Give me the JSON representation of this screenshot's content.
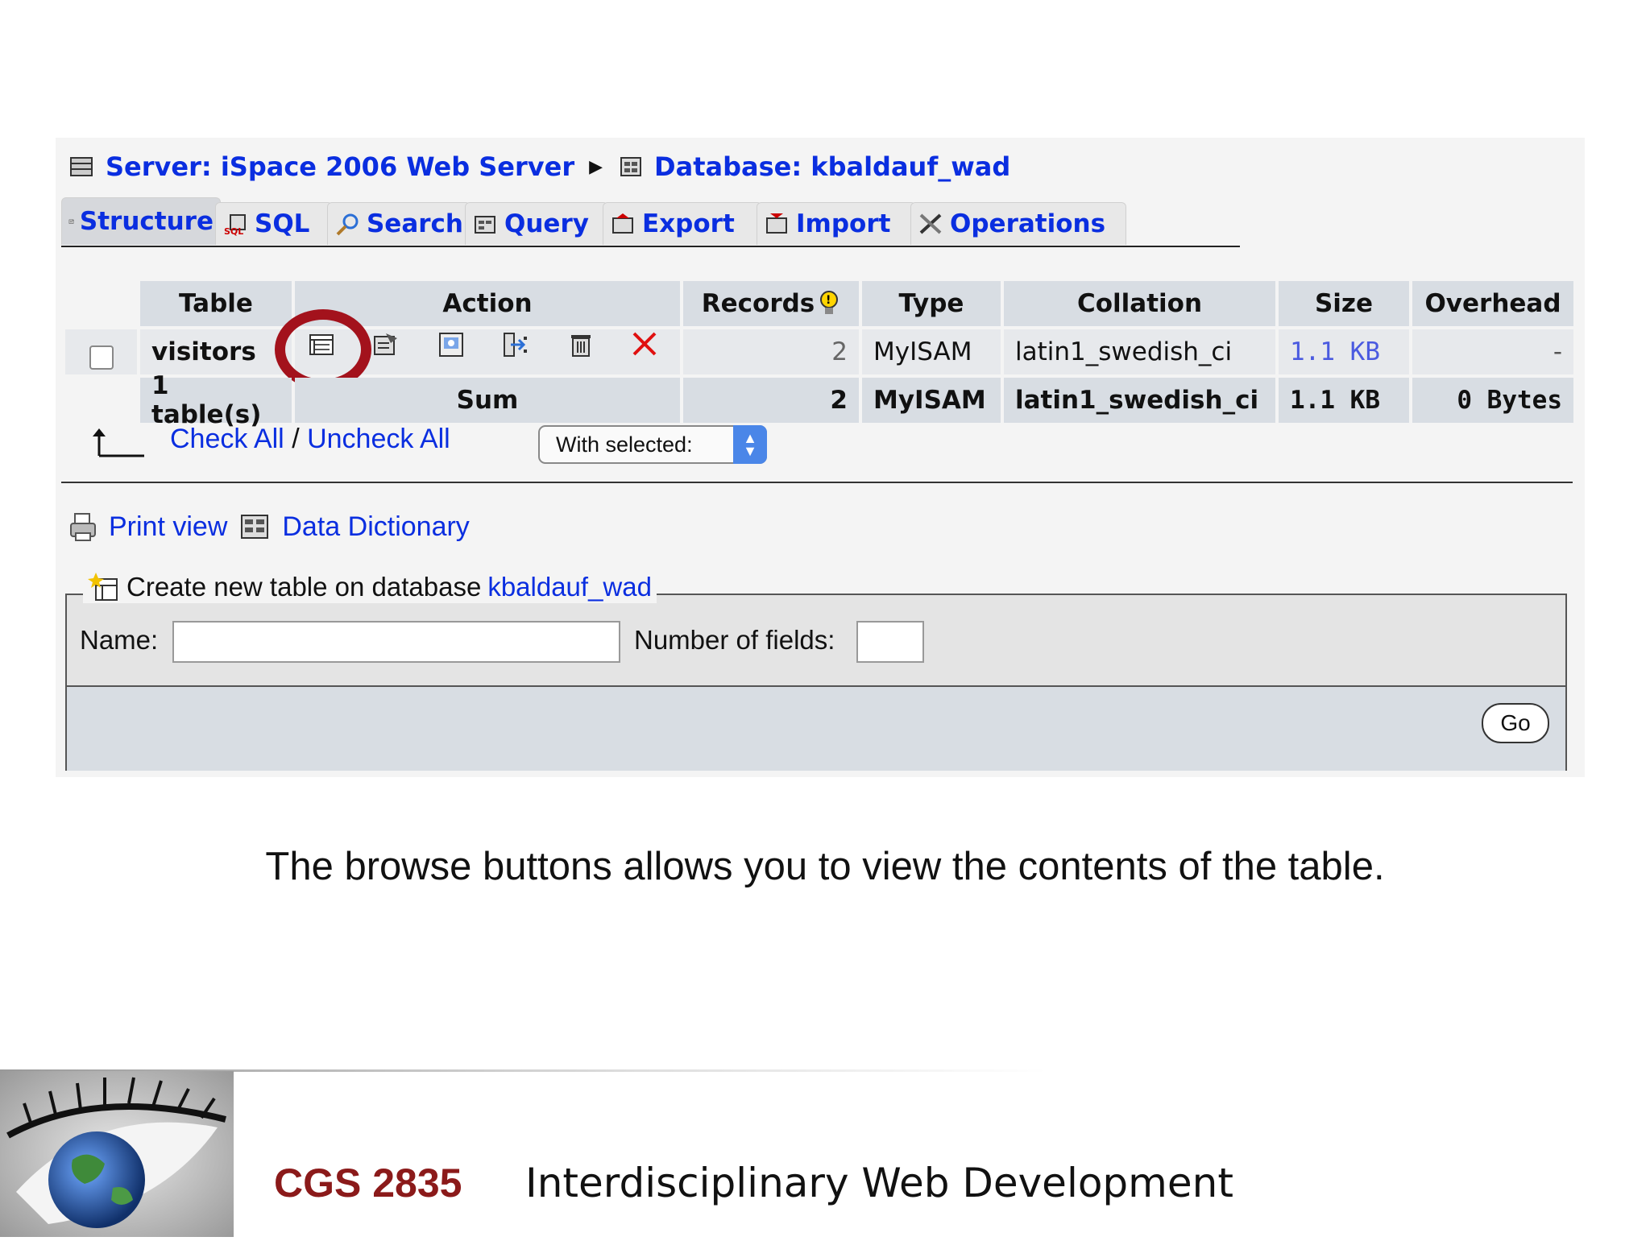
{
  "breadcrumb": {
    "server": "Server: iSpace 2006 Web Server",
    "database": "Database: kbaldauf_wad"
  },
  "tabs": [
    {
      "label": "Structure",
      "icon": "structure-icon",
      "active": true
    },
    {
      "label": "SQL",
      "icon": "sql-icon"
    },
    {
      "label": "Search",
      "icon": "search-icon"
    },
    {
      "label": "Query",
      "icon": "query-icon"
    },
    {
      "label": "Export",
      "icon": "export-icon"
    },
    {
      "label": "Import",
      "icon": "import-icon"
    },
    {
      "label": "Operations",
      "icon": "operations-icon"
    }
  ],
  "table": {
    "headers": {
      "table": "Table",
      "action": "Action",
      "records": "Records",
      "type": "Type",
      "collation": "Collation",
      "size": "Size",
      "overhead": "Overhead"
    },
    "rows": [
      {
        "name": "visitors",
        "records": "2",
        "type": "MyISAM",
        "collation": "latin1_swedish_ci",
        "size": "1.1 KB",
        "overhead": "-",
        "actions": [
          "browse-icon",
          "structure-icon",
          "search-icon",
          "insert-icon",
          "empty-icon",
          "drop-icon"
        ]
      }
    ],
    "sum": {
      "tables": "1 table(s)",
      "label": "Sum",
      "records": "2",
      "type": "MyISAM",
      "collation": "latin1_swedish_ci",
      "size": "1.1 KB",
      "overhead": "0 Bytes"
    }
  },
  "selection": {
    "check_all": "Check All",
    "separator": "/",
    "uncheck_all": "Uncheck All",
    "with_selected": "With selected:"
  },
  "links": {
    "print_view": "Print view",
    "data_dictionary": "Data Dictionary"
  },
  "create_table": {
    "legend": "Create new table on database",
    "database": "kbaldauf_wad",
    "name_label": "Name:",
    "fields_label": "Number of fields:",
    "go_label": "Go"
  },
  "caption": "The browse buttons allows you to view the contents of the table.",
  "footer": {
    "course_code": "CGS 2835",
    "course_title": "Interdisciplinary Web Development"
  },
  "colors": {
    "link": "#0a2ee0",
    "highlight": "#a3121c",
    "course_code": "#8b1a1a",
    "table_header": "#d8dde3"
  }
}
